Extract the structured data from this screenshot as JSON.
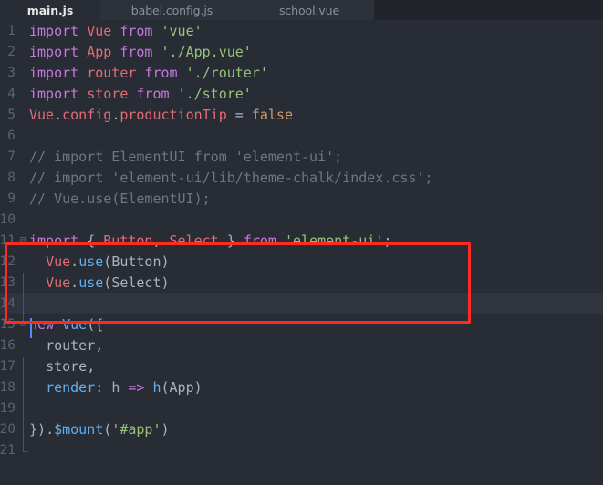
{
  "window": {
    "app": "code-editor",
    "theme": "One Dark",
    "background": "#282c34"
  },
  "tabs": [
    {
      "label": "main.js",
      "active": true
    },
    {
      "label": "babel.config.js",
      "active": false
    },
    {
      "label": "school.vue",
      "active": false
    }
  ],
  "editor": {
    "filename": "main.js",
    "cursor_line": 14,
    "current_line_highlight": true,
    "line_numbers": [
      "1",
      "2",
      "3",
      "4",
      "5",
      "6",
      "7",
      "8",
      "9",
      "10",
      "11",
      "12",
      "13",
      "14",
      "15",
      "16",
      "17",
      "18",
      "19",
      "20",
      "21"
    ],
    "lines": [
      {
        "n": "1",
        "tokens": [
          {
            "t": "import",
            "c": "kw"
          },
          {
            "t": " ",
            "c": "plain"
          },
          {
            "t": "Vue",
            "c": "cls"
          },
          {
            "t": " ",
            "c": "plain"
          },
          {
            "t": "from",
            "c": "kw"
          },
          {
            "t": " ",
            "c": "plain"
          },
          {
            "t": "'vue'",
            "c": "str"
          }
        ]
      },
      {
        "n": "2",
        "tokens": [
          {
            "t": "import",
            "c": "kw"
          },
          {
            "t": " ",
            "c": "plain"
          },
          {
            "t": "App",
            "c": "cls"
          },
          {
            "t": " ",
            "c": "plain"
          },
          {
            "t": "from",
            "c": "kw"
          },
          {
            "t": " ",
            "c": "plain"
          },
          {
            "t": "'./App.vue'",
            "c": "str"
          }
        ]
      },
      {
        "n": "3",
        "tokens": [
          {
            "t": "import",
            "c": "kw"
          },
          {
            "t": " ",
            "c": "plain"
          },
          {
            "t": "router",
            "c": "cls"
          },
          {
            "t": " ",
            "c": "plain"
          },
          {
            "t": "from",
            "c": "kw"
          },
          {
            "t": " ",
            "c": "plain"
          },
          {
            "t": "'./router'",
            "c": "str"
          }
        ]
      },
      {
        "n": "4",
        "tokens": [
          {
            "t": "import",
            "c": "kw"
          },
          {
            "t": " ",
            "c": "plain"
          },
          {
            "t": "store",
            "c": "cls"
          },
          {
            "t": " ",
            "c": "plain"
          },
          {
            "t": "from",
            "c": "kw"
          },
          {
            "t": " ",
            "c": "plain"
          },
          {
            "t": "'./store'",
            "c": "str"
          }
        ]
      },
      {
        "n": "5",
        "tokens": [
          {
            "t": "Vue",
            "c": "cls"
          },
          {
            "t": ".",
            "c": "punc"
          },
          {
            "t": "config",
            "c": "cls"
          },
          {
            "t": ".",
            "c": "punc"
          },
          {
            "t": "productionTip",
            "c": "cls"
          },
          {
            "t": " ",
            "c": "plain"
          },
          {
            "t": "=",
            "c": "plain"
          },
          {
            "t": " ",
            "c": "plain"
          },
          {
            "t": "false",
            "c": "num"
          }
        ]
      },
      {
        "n": "6",
        "tokens": []
      },
      {
        "n": "7",
        "tokens": [
          {
            "t": "// import ElementUI from 'element-ui';",
            "c": "cmt"
          }
        ]
      },
      {
        "n": "8",
        "tokens": [
          {
            "t": "// import 'element-ui/lib/theme-chalk/index.css';",
            "c": "cmt"
          }
        ]
      },
      {
        "n": "9",
        "tokens": [
          {
            "t": "// Vue.use(ElementUI);",
            "c": "cmt"
          }
        ]
      },
      {
        "n": "10",
        "tokens": []
      },
      {
        "n": "11",
        "tokens": [
          {
            "t": "import",
            "c": "kw"
          },
          {
            "t": " ",
            "c": "plain"
          },
          {
            "t": "{",
            "c": "punc"
          },
          {
            "t": " ",
            "c": "plain"
          },
          {
            "t": "Button",
            "c": "cls"
          },
          {
            "t": ",",
            "c": "punc"
          },
          {
            "t": " ",
            "c": "plain"
          },
          {
            "t": "Select",
            "c": "cls"
          },
          {
            "t": " ",
            "c": "plain"
          },
          {
            "t": "}",
            "c": "punc"
          },
          {
            "t": " ",
            "c": "plain"
          },
          {
            "t": "from",
            "c": "kw"
          },
          {
            "t": " ",
            "c": "plain"
          },
          {
            "t": "'element-ui'",
            "c": "str"
          },
          {
            "t": ";",
            "c": "punc"
          }
        ]
      },
      {
        "n": "12",
        "tokens": [
          {
            "t": "  ",
            "c": "plain"
          },
          {
            "t": "Vue",
            "c": "cls"
          },
          {
            "t": ".",
            "c": "punc"
          },
          {
            "t": "use",
            "c": "fn"
          },
          {
            "t": "(",
            "c": "punc"
          },
          {
            "t": "Button",
            "c": "plain"
          },
          {
            "t": ")",
            "c": "punc"
          }
        ]
      },
      {
        "n": "13",
        "tokens": [
          {
            "t": "  ",
            "c": "plain"
          },
          {
            "t": "Vue",
            "c": "cls"
          },
          {
            "t": ".",
            "c": "punc"
          },
          {
            "t": "use",
            "c": "fn"
          },
          {
            "t": "(",
            "c": "punc"
          },
          {
            "t": "Select",
            "c": "plain"
          },
          {
            "t": ")",
            "c": "punc"
          }
        ]
      },
      {
        "n": "14",
        "tokens": []
      },
      {
        "n": "15",
        "tokens": [
          {
            "t": "new",
            "c": "kw"
          },
          {
            "t": " ",
            "c": "plain"
          },
          {
            "t": "Vue",
            "c": "fn"
          },
          {
            "t": "(",
            "c": "punc"
          },
          {
            "t": "{",
            "c": "punc"
          }
        ]
      },
      {
        "n": "16",
        "tokens": [
          {
            "t": "  ",
            "c": "plain"
          },
          {
            "t": "router",
            "c": "plain"
          },
          {
            "t": ",",
            "c": "punc"
          }
        ]
      },
      {
        "n": "17",
        "tokens": [
          {
            "t": "  ",
            "c": "plain"
          },
          {
            "t": "store",
            "c": "plain"
          },
          {
            "t": ",",
            "c": "punc"
          }
        ]
      },
      {
        "n": "18",
        "tokens": [
          {
            "t": "  ",
            "c": "plain"
          },
          {
            "t": "render",
            "c": "fn"
          },
          {
            "t": ":",
            "c": "punc"
          },
          {
            "t": " ",
            "c": "plain"
          },
          {
            "t": "h",
            "c": "plain"
          },
          {
            "t": " ",
            "c": "plain"
          },
          {
            "t": "=>",
            "c": "op"
          },
          {
            "t": " ",
            "c": "plain"
          },
          {
            "t": "h",
            "c": "fn"
          },
          {
            "t": "(",
            "c": "punc"
          },
          {
            "t": "App",
            "c": "plain"
          },
          {
            "t": ")",
            "c": "punc"
          }
        ]
      },
      {
        "n": "19",
        "tokens": []
      },
      {
        "n": "20",
        "tokens": [
          {
            "t": "}",
            "c": "punc"
          },
          {
            "t": ")",
            "c": "punc"
          },
          {
            "t": ".",
            "c": "punc"
          },
          {
            "t": "$mount",
            "c": "fn"
          },
          {
            "t": "(",
            "c": "punc"
          },
          {
            "t": "'#app'",
            "c": "str"
          },
          {
            "t": ")",
            "c": "punc"
          }
        ]
      },
      {
        "n": "21",
        "tokens": []
      }
    ],
    "fold_markers": [
      {
        "line": "11",
        "glyph": "⊟"
      },
      {
        "line": "15",
        "glyph": "⊟"
      }
    ]
  },
  "annotation": {
    "type": "red-rectangle",
    "color": "#ff2b20",
    "covers_lines": [
      "11",
      "12",
      "13"
    ]
  }
}
